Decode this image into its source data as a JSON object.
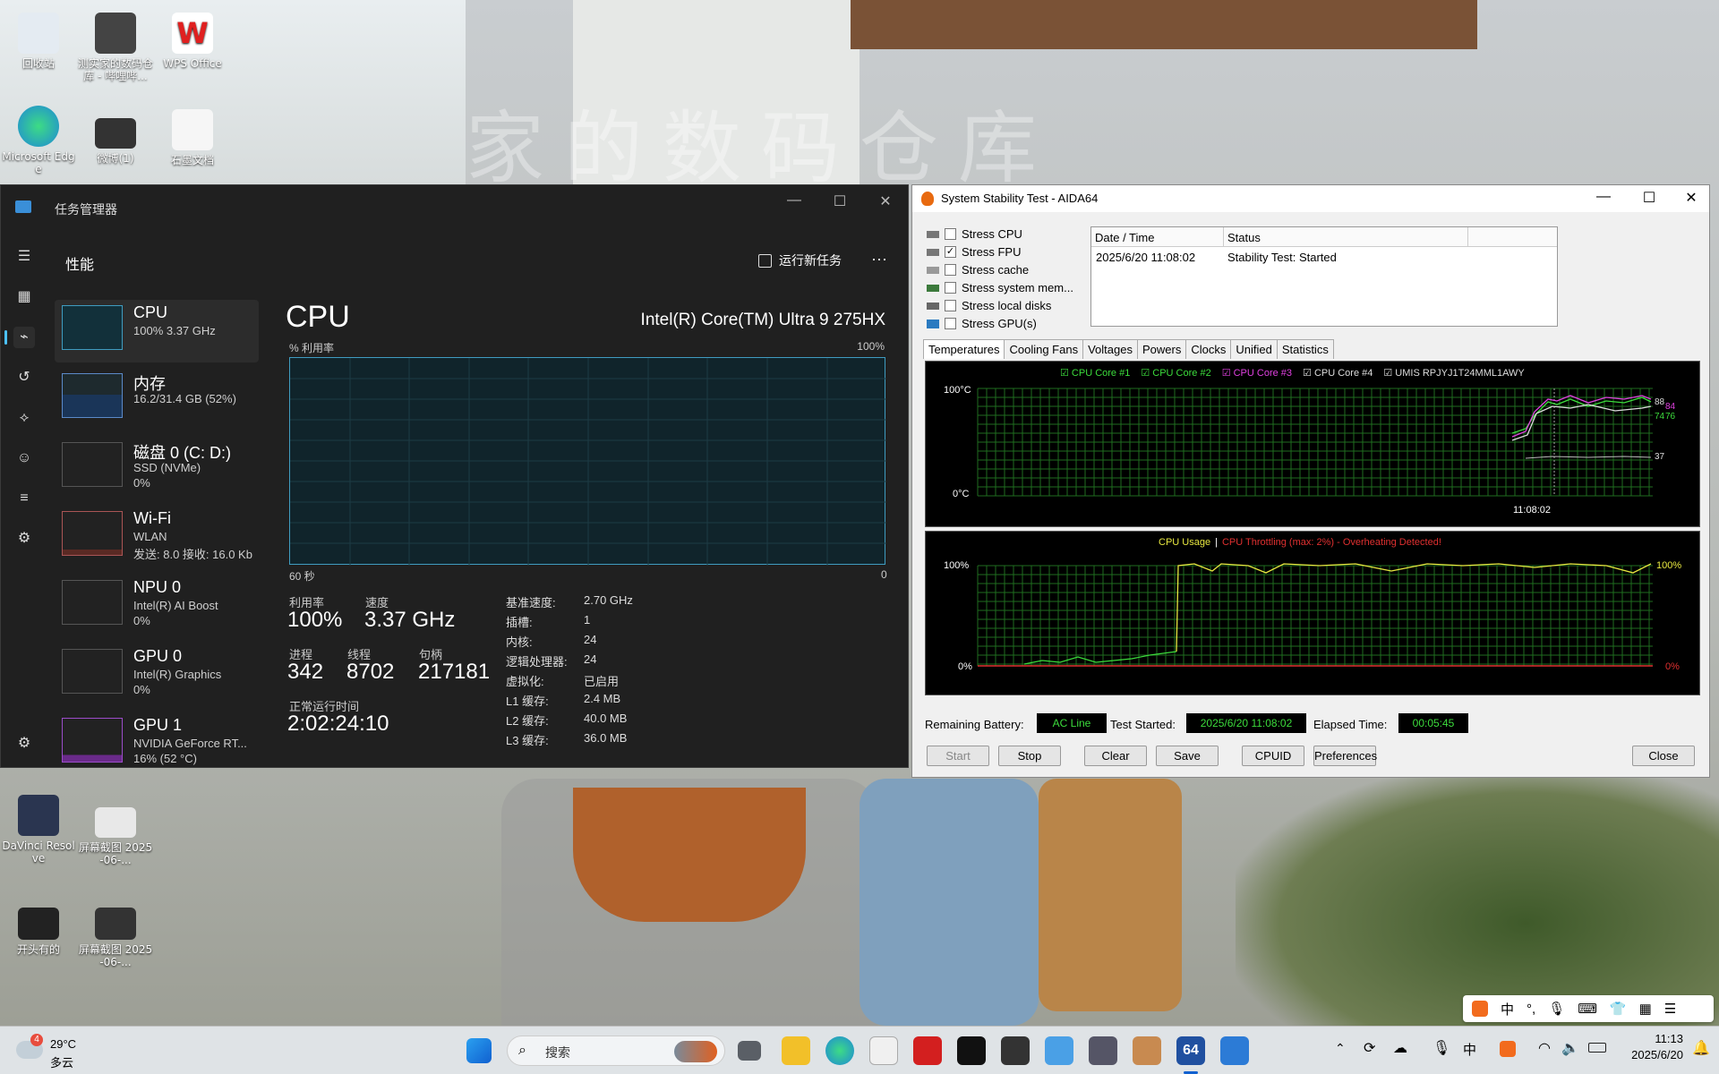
{
  "desktop": {
    "watermark": "家的数码仓库",
    "icons": [
      {
        "label": "回收站",
        "x": "",
        "color": "#dfe6ef"
      },
      {
        "label": "测实家的数码仓库 - 哔哩哔...",
        "color": "#444"
      },
      {
        "label": "WPS Office",
        "color": "#e02020"
      },
      {
        "label": "Microsoft Edge",
        "color": "#1e88d8"
      },
      {
        "label": "微博(1)",
        "color": "#333"
      },
      {
        "label": "石墨文档",
        "color": "#f5f5f5"
      },
      {
        "label": "DaVinci Resolve",
        "color": "#2a3550"
      },
      {
        "label": "屏幕截图 2025-06-...",
        "color": "#e8e8e8"
      },
      {
        "label": "开头有的",
        "color": "#222"
      },
      {
        "label": "屏幕截图 2025-06-...",
        "color": "#333"
      }
    ]
  },
  "taskmanager": {
    "title": "任务管理器",
    "section": "性能",
    "run_new_task": "运行新任务",
    "more": "···",
    "items": [
      {
        "name": "CPU",
        "s1": "100%  3.37 GHz",
        "s2": ""
      },
      {
        "name": "内存",
        "s1": "16.2/31.4 GB (52%)",
        "s2": ""
      },
      {
        "name": "磁盘 0 (C: D:)",
        "s1": "SSD (NVMe)",
        "s2": "0%"
      },
      {
        "name": "Wi-Fi",
        "s1": "WLAN",
        "s2": "发送: 8.0  接收: 16.0 Kb"
      },
      {
        "name": "NPU 0",
        "s1": "Intel(R) AI Boost",
        "s2": "0%"
      },
      {
        "name": "GPU 0",
        "s1": "Intel(R) Graphics",
        "s2": "0%"
      },
      {
        "name": "GPU 1",
        "s1": "NVIDIA GeForce RT...",
        "s2": "16% (52 °C)"
      }
    ],
    "main": {
      "title": "CPU",
      "model": "Intel(R) Core(TM) Ultra 9 275HX",
      "util_label": "% 利用率",
      "util_max": "100%",
      "time_left": "60 秒",
      "time_right": "0",
      "stats": {
        "util_lbl": "利用率",
        "util": "100%",
        "speed_lbl": "速度",
        "speed": "3.37 GHz",
        "proc_lbl": "进程",
        "proc": "342",
        "thread_lbl": "线程",
        "thread": "8702",
        "handle_lbl": "句柄",
        "handle": "217181",
        "uptime_lbl": "正常运行时间",
        "uptime": "2:02:24:10"
      },
      "details": [
        {
          "k": "基准速度:",
          "v": "2.70 GHz"
        },
        {
          "k": "插槽:",
          "v": "1"
        },
        {
          "k": "内核:",
          "v": "24"
        },
        {
          "k": "逻辑处理器:",
          "v": "24"
        },
        {
          "k": "虚拟化:",
          "v": "已启用"
        },
        {
          "k": "L1 缓存:",
          "v": "2.4 MB"
        },
        {
          "k": "L2 缓存:",
          "v": "40.0 MB"
        },
        {
          "k": "L3 缓存:",
          "v": "36.0 MB"
        }
      ]
    }
  },
  "aida": {
    "title": "System Stability Test - AIDA64",
    "stress": [
      {
        "label": "Stress CPU",
        "checked": false
      },
      {
        "label": "Stress FPU",
        "checked": true
      },
      {
        "label": "Stress cache",
        "checked": false
      },
      {
        "label": "Stress system mem...",
        "checked": false
      },
      {
        "label": "Stress local disks",
        "checked": false
      },
      {
        "label": "Stress GPU(s)",
        "checked": false
      }
    ],
    "log_headers": [
      "Date / Time",
      "Status"
    ],
    "log_rows": [
      {
        "time": "2025/6/20 11:08:02",
        "status": "Stability Test: Started"
      }
    ],
    "tabs": [
      "Temperatures",
      "Cooling Fans",
      "Voltages",
      "Powers",
      "Clocks",
      "Unified",
      "Statistics"
    ],
    "temp_legend": [
      {
        "label": "CPU Core #1",
        "color": "#3cdc3c"
      },
      {
        "label": "CPU Core #2",
        "color": "#3cdc3c"
      },
      {
        "label": "CPU Core #3",
        "color": "#e040e0"
      },
      {
        "label": "CPU Core #4",
        "color": "#dddddd"
      },
      {
        "label": "UMIS RPJYJ1T24MML1AWY",
        "color": "#dddddd"
      }
    ],
    "temp_axis": {
      "top": "100°C",
      "bottom": "0°C",
      "time": "11:08:02"
    },
    "temp_right": [
      "88",
      "84",
      "74",
      "76",
      "37"
    ],
    "usage_title": "CPU Usage",
    "usage_sep": "|",
    "usage_warn": "CPU Throttling (max: 2%) - Overheating Detected!",
    "usage_axis": {
      "top": "100%",
      "bottom": "0%",
      "right_top": "100%",
      "right_bottom": "0%"
    },
    "battery_lbl": "Remaining Battery:",
    "battery": "AC Line",
    "started_lbl": "Test Started:",
    "started": "2025/6/20 11:08:02",
    "elapsed_lbl": "Elapsed Time:",
    "elapsed": "00:05:45",
    "buttons": [
      "Start",
      "Stop",
      "Clear",
      "Save",
      "CPUID",
      "Preferences",
      "Close"
    ]
  },
  "taskbar": {
    "weather_temp": "29°C",
    "weather_desc": "多云",
    "weather_badge": "4",
    "search": "搜索",
    "ime": "中",
    "time": "11:13",
    "date": "2025/6/20",
    "active_label": "64"
  },
  "tray_ime": {
    "mode": "中"
  }
}
